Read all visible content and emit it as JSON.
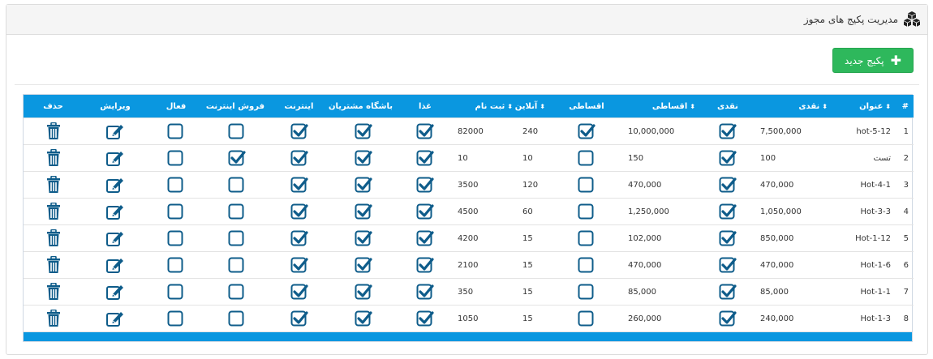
{
  "header": {
    "title": "مدیریت پکیج های مجوز",
    "icon": "cubes-icon"
  },
  "toolbar": {
    "new_label": "پکیج جدید",
    "new_icon": "plus-icon"
  },
  "table": {
    "columns": [
      "#",
      "عنوان",
      "نقدی",
      "نقدی",
      "اقساطی",
      "اقساطی",
      "آنلاین",
      "ثبت نام",
      "غذا",
      "باشگاه مشتریان",
      "اینترنت",
      "فروش اینترنت",
      "فعال",
      "ویرایش",
      "حذف"
    ],
    "rows": [
      {
        "id": "1",
        "title": "hot-5-12",
        "cash": "7,500,000",
        "cash_chk": true,
        "inst": "10,000,000",
        "inst_chk": true,
        "online": "240",
        "reg": "82000",
        "food": true,
        "club": true,
        "internet": true,
        "sale": false,
        "active": false
      },
      {
        "id": "2",
        "title": "تست",
        "cash": "100",
        "cash_chk": true,
        "inst": "150",
        "inst_chk": false,
        "online": "10",
        "reg": "10",
        "food": true,
        "club": true,
        "internet": true,
        "sale": true,
        "active": false
      },
      {
        "id": "3",
        "title": "Hot-4-1",
        "cash": "470,000",
        "cash_chk": true,
        "inst": "470,000",
        "inst_chk": false,
        "online": "120",
        "reg": "3500",
        "food": true,
        "club": true,
        "internet": true,
        "sale": false,
        "active": false
      },
      {
        "id": "4",
        "title": "Hot-3-3",
        "cash": "1,050,000",
        "cash_chk": true,
        "inst": "1,250,000",
        "inst_chk": false,
        "online": "60",
        "reg": "4500",
        "food": true,
        "club": true,
        "internet": true,
        "sale": false,
        "active": false
      },
      {
        "id": "5",
        "title": "Hot-1-12",
        "cash": "850,000",
        "cash_chk": true,
        "inst": "102,000",
        "inst_chk": false,
        "online": "15",
        "reg": "4200",
        "food": true,
        "club": true,
        "internet": true,
        "sale": false,
        "active": false
      },
      {
        "id": "6",
        "title": "Hot-1-6",
        "cash": "470,000",
        "cash_chk": true,
        "inst": "470,000",
        "inst_chk": false,
        "online": "15",
        "reg": "2100",
        "food": true,
        "club": true,
        "internet": true,
        "sale": false,
        "active": false
      },
      {
        "id": "7",
        "title": "Hot-1-1",
        "cash": "85,000",
        "cash_chk": true,
        "inst": "85,000",
        "inst_chk": false,
        "online": "15",
        "reg": "350",
        "food": true,
        "club": true,
        "internet": true,
        "sale": false,
        "active": false
      },
      {
        "id": "8",
        "title": "Hot-1-3",
        "cash": "240,000",
        "cash_chk": true,
        "inst": "260,000",
        "inst_chk": false,
        "online": "15",
        "reg": "1050",
        "food": true,
        "club": true,
        "internet": true,
        "sale": false,
        "active": false
      }
    ]
  },
  "colors": {
    "header_blue": "#0a97e0",
    "icon_blue": "#0e5c8a",
    "button_green": "#2eb85c"
  }
}
